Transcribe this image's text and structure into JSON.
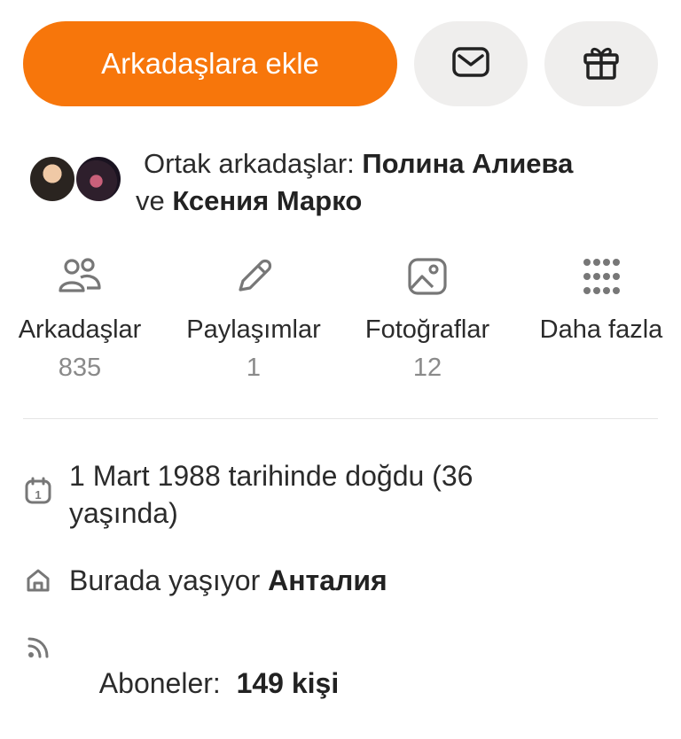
{
  "actions": {
    "add_friend_label": "Arkadaşlara ekle",
    "message_icon": "envelope-icon",
    "gift_icon": "gift-icon"
  },
  "mutual": {
    "prefix": "Ortak arkadaşlar: ",
    "friend1": "Полина Алиева",
    "and": " ve ",
    "friend2": "Ксения Марко"
  },
  "stats": [
    {
      "label": "Arkadaşlar",
      "count": "835",
      "icon": "friends-icon"
    },
    {
      "label": "Paylaşımlar",
      "count": "1",
      "icon": "pencil-icon"
    },
    {
      "label": "Fotoğraflar",
      "count": "12",
      "icon": "photo-icon"
    },
    {
      "label": "Daha fazla",
      "count": "",
      "icon": "grid-dots-icon"
    }
  ],
  "info": {
    "birthday": "1 Mart 1988 tarihinde doğdu (36 yaşında)",
    "location_prefix": "Burada yaşıyor ",
    "location_city": "Анталия",
    "subscribers_prefix": "Aboneler:  ",
    "subscribers_count": "149 kişi"
  },
  "colors": {
    "accent": "#f7760b",
    "secondary_button": "#efeeed",
    "muted_text": "#8a8a8a"
  }
}
